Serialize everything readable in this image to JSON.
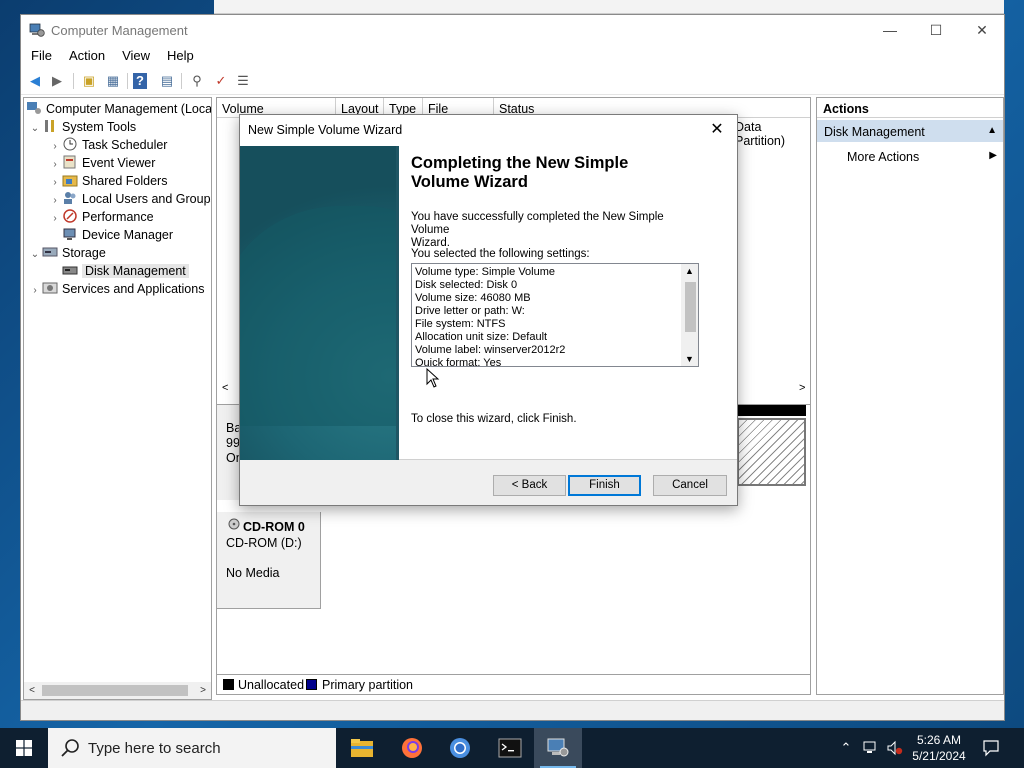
{
  "window": {
    "title": "Computer Management",
    "minimize_label": "—",
    "maximize_label": "☐",
    "close_label": "✕"
  },
  "menu": [
    "File",
    "Action",
    "View",
    "Help"
  ],
  "tree": {
    "items": [
      {
        "label": "Computer Management (Local",
        "icon": "computer-management-icon"
      },
      {
        "label": "System Tools",
        "icon": "tools-icon"
      },
      {
        "label": "Task Scheduler",
        "icon": "clock-icon"
      },
      {
        "label": "Event Viewer",
        "icon": "event-viewer-icon"
      },
      {
        "label": "Shared Folders",
        "icon": "shared-folder-icon"
      },
      {
        "label": "Local Users and Groups",
        "icon": "users-icon"
      },
      {
        "label": "Performance",
        "icon": "performance-icon"
      },
      {
        "label": "Device Manager",
        "icon": "device-manager-icon"
      },
      {
        "label": "Storage",
        "icon": "storage-icon"
      },
      {
        "label": "Disk Management",
        "icon": "disk-icon"
      },
      {
        "label": "Services and Applications",
        "icon": "services-icon"
      }
    ]
  },
  "volume_list": {
    "columns": [
      "Volume",
      "Layout",
      "Type",
      "File System",
      "Status"
    ],
    "row_fragment": "Data Partition)"
  },
  "disk0": {
    "line1": "Ba",
    "line2": "99",
    "line3": "On"
  },
  "cdrom": {
    "name": "CD-ROM 0",
    "type": "CD-ROM (D:)",
    "media": "No Media"
  },
  "legend": {
    "unallocated": "Unallocated",
    "primary": "Primary partition",
    "unallocated_color": "#000000",
    "primary_color": "#00008b"
  },
  "actions": {
    "title": "Actions",
    "section": "Disk Management",
    "more": "More Actions"
  },
  "wizard": {
    "title": "New Simple Volume Wizard",
    "close_label": "✕",
    "heading_line1": "Completing the New Simple",
    "heading_line2": "Volume Wizard",
    "intro_line1": "You have successfully completed the New Simple Volume",
    "intro_line2": "Wizard.",
    "settings_label": "You selected the following settings:",
    "settings": [
      "Volume type: Simple Volume",
      "Disk selected: Disk 0",
      "Volume size: 46080 MB",
      "Drive letter or path: W:",
      "File system: NTFS",
      "Allocation unit size: Default",
      "Volume label: winserver2012r2",
      "Quick format: Yes"
    ],
    "close_hint": "To close this wizard, click Finish.",
    "back_label": "< Back",
    "finish_label": "Finish",
    "cancel_label": "Cancel"
  },
  "taskbar": {
    "search_placeholder": "Type here to search",
    "time": "5:26 AM",
    "date": "5/21/2024",
    "apps": [
      "file-explorer-icon",
      "firefox-icon",
      "chrome-icon",
      "terminal-icon",
      "computer-management-icon"
    ]
  }
}
